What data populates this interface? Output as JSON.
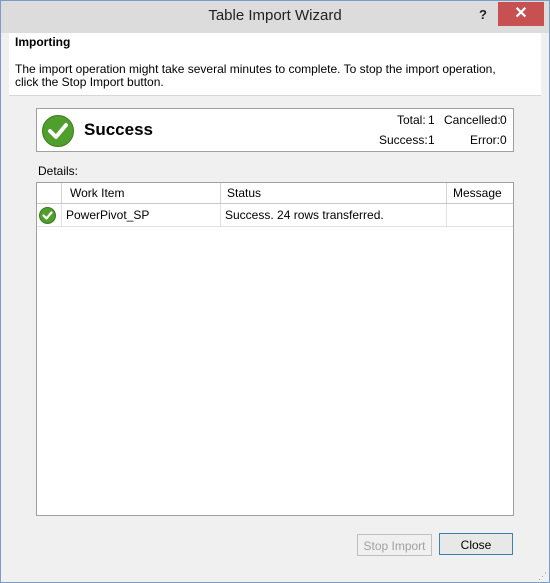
{
  "window": {
    "title": "Table Import Wizard",
    "help_label": "?",
    "close_label": "✕"
  },
  "header": {
    "title": "Importing",
    "description": "The import operation might take several minutes to complete. To stop the import operation, click the Stop Import button."
  },
  "status": {
    "label": "Success",
    "icon": "success-check-icon",
    "total_label": "Total:",
    "total_value": "1",
    "cancelled_label": "Cancelled:",
    "cancelled_value": "0",
    "success_label": "Success:",
    "success_value": "1",
    "error_label": "Error:",
    "error_value": "0",
    "accent_color": "#4e9f2b"
  },
  "details": {
    "label": "Details:",
    "columns": [
      "Work Item",
      "Status",
      "Message"
    ],
    "rows": [
      {
        "icon": "success-check-icon",
        "work_item": "PowerPivot_SP",
        "status": "Success. 24 rows transferred.",
        "message": ""
      }
    ]
  },
  "buttons": {
    "stop_import": "Stop Import",
    "close": "Close"
  }
}
